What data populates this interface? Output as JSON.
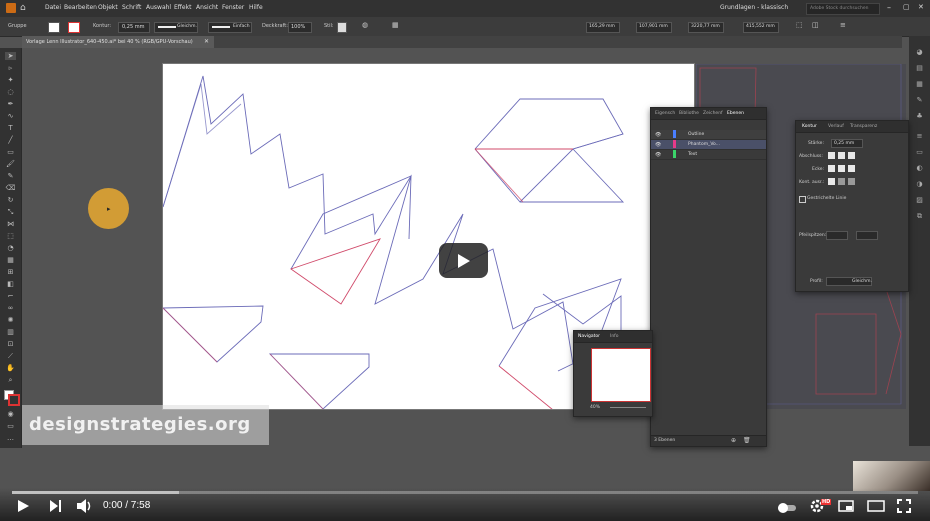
{
  "menubar": {
    "items": [
      "Datei",
      "Bearbeiten",
      "Objekt",
      "Schrift",
      "Auswahl",
      "Effekt",
      "Ansicht",
      "Fenster",
      "Hilfe"
    ],
    "workspace": "Grundlagen - klassisch",
    "search_placeholder": "Adobe Stock durchsuchen"
  },
  "control_bar": {
    "selection_label": "Gruppe",
    "stroke_label": "Kontur:",
    "stroke_value": "0,25 mm",
    "profile_value": "Gleichm.",
    "brush_value": "Einfach",
    "opacity_label": "Deckkraft:",
    "opacity_value": "100%",
    "style_label": "Stil:",
    "x_value": "165,29 mm",
    "y_value": "107,901 mm",
    "w_value": "3220,77 mm",
    "h_value": "415,552 mm"
  },
  "document_tab": {
    "title": "Vorlage Lenn Illustrator_640-450.ai* bei 40 % (RGB/GPU-Vorschau)",
    "close": "✕"
  },
  "layers_panel": {
    "tabs": [
      "Eigensch",
      "Bibliothe",
      "Zeichenf",
      "Ebenen"
    ],
    "active_tab": "Ebenen",
    "layers": [
      {
        "name": "Outline",
        "color": "#4a7fff"
      },
      {
        "name": "Phantom_Vo...",
        "color": "#e63a8a"
      },
      {
        "name": "Text",
        "color": "#3bd46a"
      }
    ],
    "footer": "3 Ebenen"
  },
  "navigator_panel": {
    "tabs": [
      "Navigator",
      "Info"
    ],
    "zoom": "40%"
  },
  "stroke_panel": {
    "tabs": [
      "Kontur",
      "Verlauf",
      "Transparenz"
    ],
    "weight_label": "Stärke:",
    "weight_value": "0,25 mm",
    "cap_label": "Abschluss:",
    "corner_label": "Ecke:",
    "align_label": "Kont. ausr.:",
    "dashed_label": "Gestrichelte Linie",
    "arrow_label": "Pfeilspitzen:",
    "profile_label": "Profil:",
    "profile_value": "Gleichm."
  },
  "watermark": "designstrategies.org",
  "video": {
    "time": "0:00 / 7:58",
    "progress_fraction": 0.0,
    "hd_badge": "HD"
  },
  "colors": {
    "accent_cursor": "#e0a532",
    "outline_blue": "#6b6bb8",
    "phantom_red": "#d04a6a"
  }
}
